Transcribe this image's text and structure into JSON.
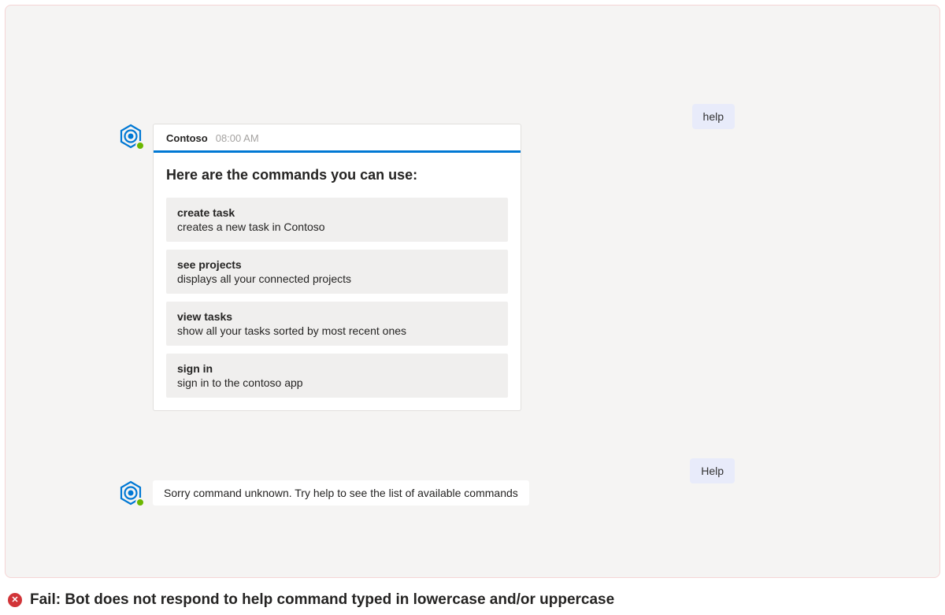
{
  "userMessages": {
    "first": "help",
    "second": "Help"
  },
  "bot": {
    "name": "Contoso",
    "timestamp": "08:00 AM"
  },
  "card": {
    "title": "Here are the commands you can use:",
    "accentColor": "#0078d4",
    "commands": [
      {
        "name": "create task",
        "desc": "creates a new task in Contoso"
      },
      {
        "name": "see projects",
        "desc": "displays all your connected projects"
      },
      {
        "name": "view tasks",
        "desc": "show all your tasks sorted by most recent ones"
      },
      {
        "name": "sign in",
        "desc": "sign in to the contoso app"
      }
    ]
  },
  "plainResponse": "Sorry command unknown. Try help to see the list of available commands",
  "failMessage": "Fail: Bot does not respond to help command typed in lowercase and/or uppercase"
}
